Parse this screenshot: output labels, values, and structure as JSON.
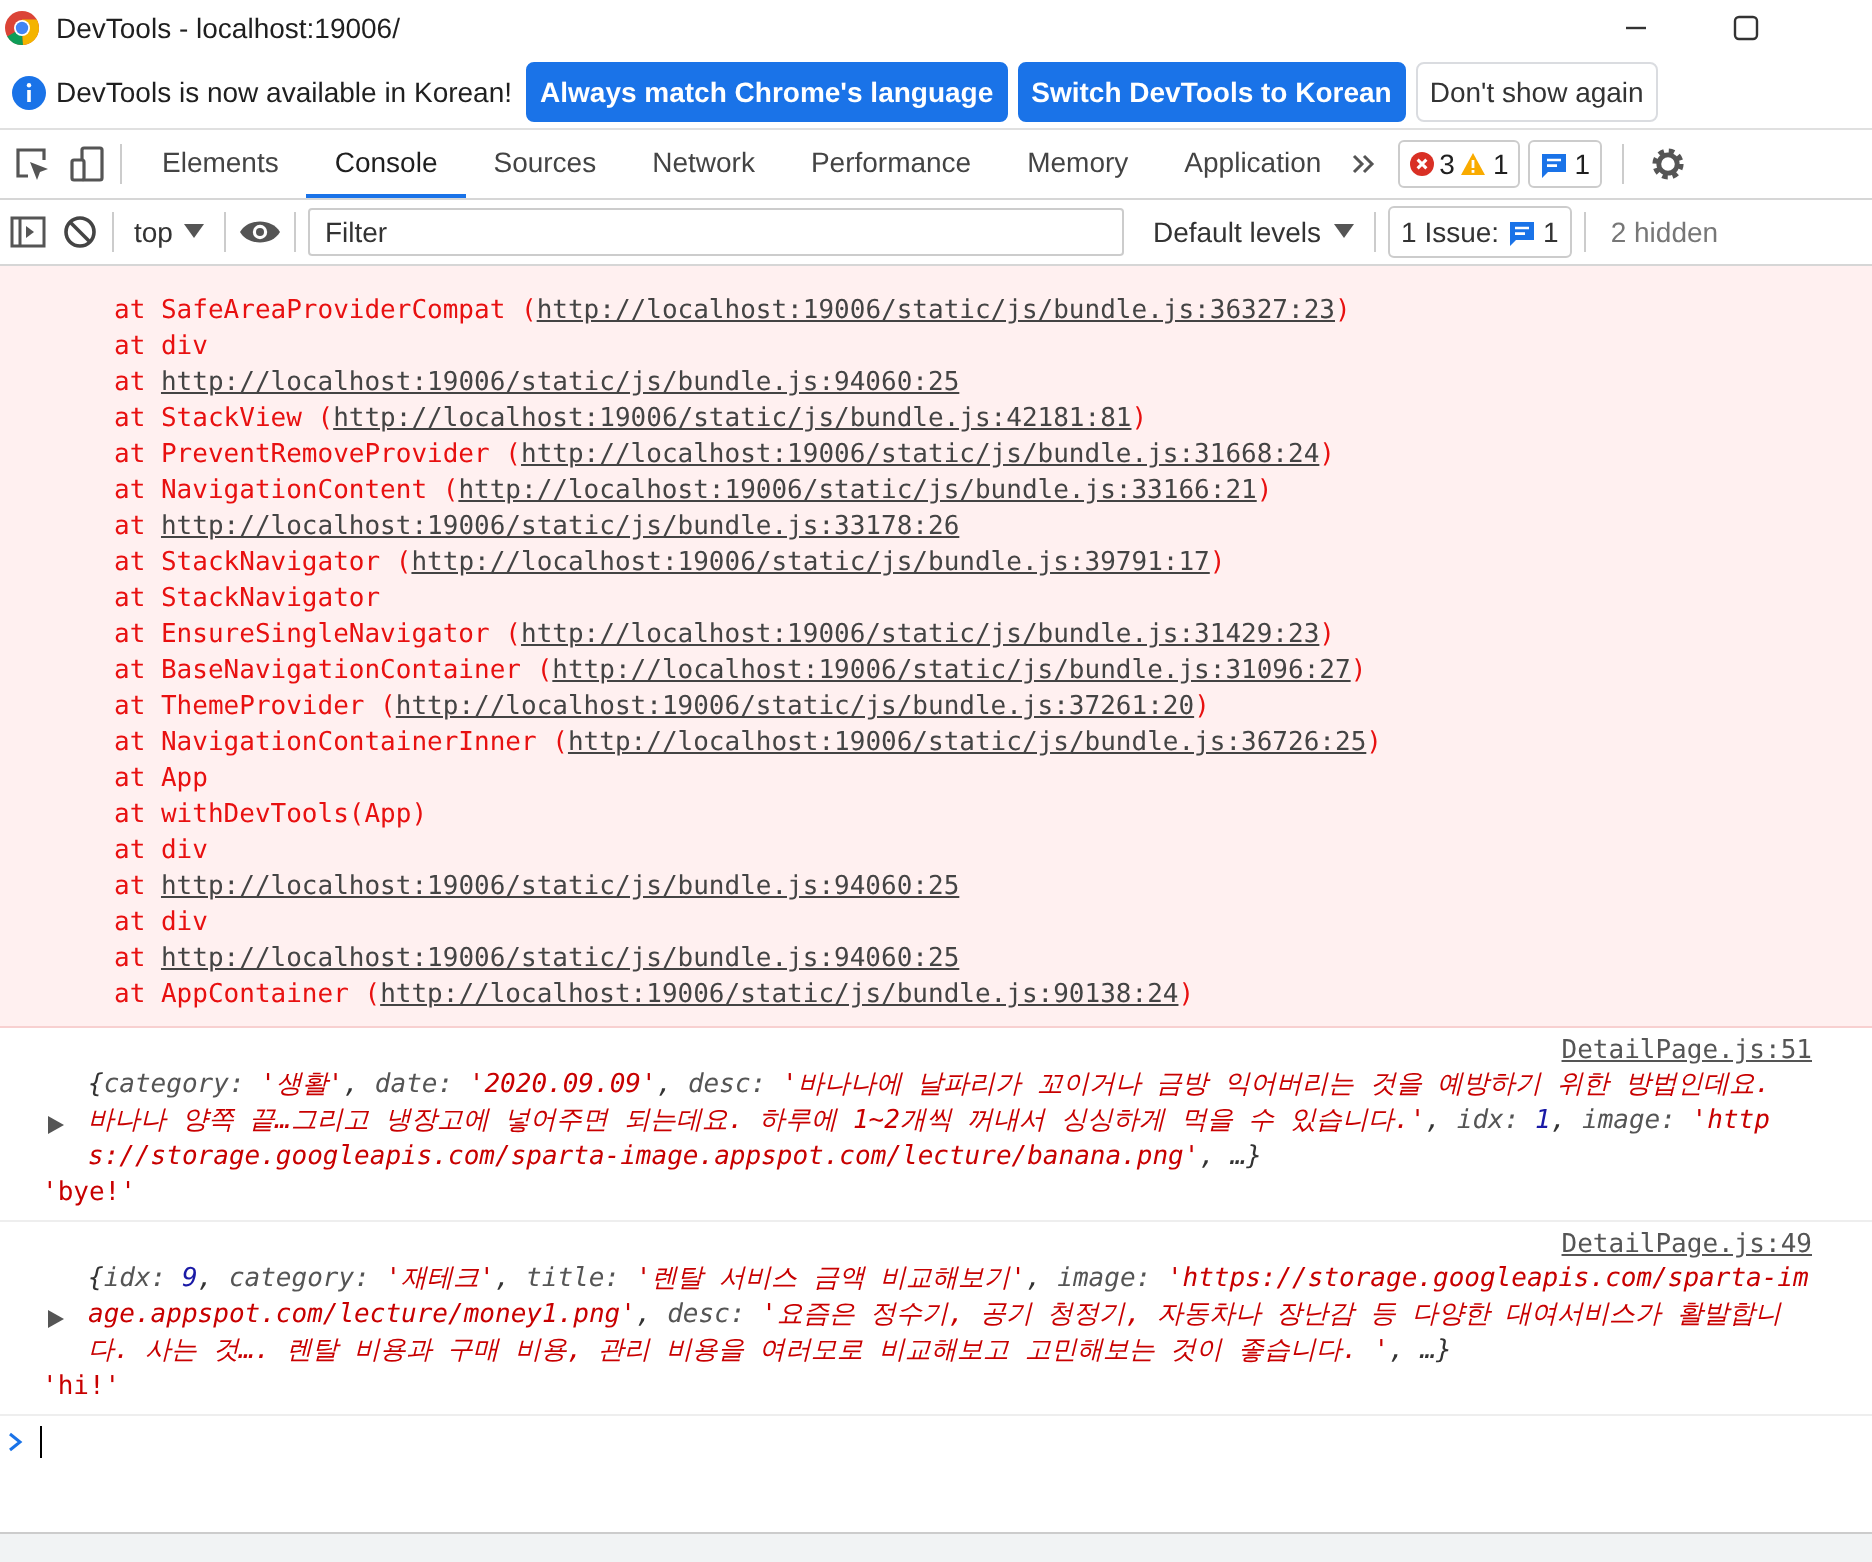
{
  "window": {
    "title": "DevTools - localhost:19006/"
  },
  "infobar": {
    "message": "DevTools is now available in Korean!",
    "buttons": [
      {
        "label": "Always match Chrome's language",
        "kind": "primary"
      },
      {
        "label": "Switch DevTools to Korean",
        "kind": "primary"
      },
      {
        "label": "Don't show again",
        "kind": "secondary"
      }
    ]
  },
  "tabs": [
    {
      "label": "Elements",
      "selected": false
    },
    {
      "label": "Console",
      "selected": true
    },
    {
      "label": "Sources",
      "selected": false
    },
    {
      "label": "Network",
      "selected": false
    },
    {
      "label": "Performance",
      "selected": false
    },
    {
      "label": "Memory",
      "selected": false
    },
    {
      "label": "Application",
      "selected": false
    }
  ],
  "counters": {
    "errors": "3",
    "warnings": "1",
    "messages": "1"
  },
  "console_toolbar": {
    "context": "top",
    "filter_placeholder": "Filter",
    "levels": "Default levels",
    "issues_label": "1 Issue:",
    "issues_count": "1",
    "hidden": "2 hidden"
  },
  "error_stack": [
    {
      "text": "at SafeAreaProviderCompat (",
      "link": "http://localhost:19006/static/js/bundle.js:36327:23",
      "after": ")"
    },
    {
      "text": "at div"
    },
    {
      "text": "at ",
      "link": "http://localhost:19006/static/js/bundle.js:94060:25"
    },
    {
      "text": "at StackView (",
      "link": "http://localhost:19006/static/js/bundle.js:42181:81",
      "after": ")"
    },
    {
      "text": "at PreventRemoveProvider (",
      "link": "http://localhost:19006/static/js/bundle.js:31668:24",
      "after": ")"
    },
    {
      "text": "at NavigationContent (",
      "link": "http://localhost:19006/static/js/bundle.js:33166:21",
      "after": ")"
    },
    {
      "text": "at ",
      "link": "http://localhost:19006/static/js/bundle.js:33178:26"
    },
    {
      "text": "at StackNavigator (",
      "link": "http://localhost:19006/static/js/bundle.js:39791:17",
      "after": ")"
    },
    {
      "text": "at StackNavigator"
    },
    {
      "text": "at EnsureSingleNavigator (",
      "link": "http://localhost:19006/static/js/bundle.js:31429:23",
      "after": ")"
    },
    {
      "text": "at BaseNavigationContainer (",
      "link": "http://localhost:19006/static/js/bundle.js:31096:27",
      "after": ")"
    },
    {
      "text": "at ThemeProvider (",
      "link": "http://localhost:19006/static/js/bundle.js:37261:20",
      "after": ")"
    },
    {
      "text": "at NavigationContainerInner (",
      "link": "http://localhost:19006/static/js/bundle.js:36726:25",
      "after": ")"
    },
    {
      "text": "at App"
    },
    {
      "text": "at withDevTools(App)"
    },
    {
      "text": "at div"
    },
    {
      "text": "at ",
      "link": "http://localhost:19006/static/js/bundle.js:94060:25"
    },
    {
      "text": "at div"
    },
    {
      "text": "at ",
      "link": "http://localhost:19006/static/js/bundle.js:94060:25"
    },
    {
      "text": "at AppContainer (",
      "link": "http://localhost:19006/static/js/bundle.js:90138:24",
      "after": ")"
    }
  ],
  "messages": [
    {
      "source": "DetailPage.js:51",
      "items": [
        {
          "kind": "object",
          "expanded": false,
          "tokens": [
            {
              "kind": "punct",
              "text": "{"
            },
            {
              "kind": "key",
              "text": "category: "
            },
            {
              "kind": "string",
              "text": "'생활'"
            },
            {
              "kind": "punct",
              "text": ", "
            },
            {
              "kind": "key",
              "text": "date: "
            },
            {
              "kind": "string",
              "text": "'2020.09.09'"
            },
            {
              "kind": "punct",
              "text": ", "
            },
            {
              "kind": "key",
              "text": "desc: "
            },
            {
              "kind": "string",
              "text": "'바나나에 날파리가 꼬이거나 금방 익어버리는 것을 예방하기 위한 방법인데요. 바나나 양쪽 끝…그리고 냉장고에 넣어주면 되는데요. 하루에 1~2개씩 꺼내서 싱싱하게 먹을 수 있습니다.'"
            },
            {
              "kind": "punct",
              "text": ", "
            },
            {
              "kind": "key",
              "text": "idx: "
            },
            {
              "kind": "number",
              "text": "1"
            },
            {
              "kind": "punct",
              "text": ", "
            },
            {
              "kind": "key",
              "text": "image: "
            },
            {
              "kind": "string",
              "text": "'https://storage.googleapis.com/sparta-image.appspot.com/lecture/banana.png'"
            },
            {
              "kind": "punct",
              "text": ", …}"
            }
          ]
        },
        {
          "kind": "string",
          "text": "'bye!'"
        }
      ]
    },
    {
      "source": "DetailPage.js:49",
      "items": [
        {
          "kind": "object",
          "expanded": false,
          "tokens": [
            {
              "kind": "punct",
              "text": "{"
            },
            {
              "kind": "key",
              "text": "idx: "
            },
            {
              "kind": "number",
              "text": "9"
            },
            {
              "kind": "punct",
              "text": ", "
            },
            {
              "kind": "key",
              "text": "category: "
            },
            {
              "kind": "string",
              "text": "'재테크'"
            },
            {
              "kind": "punct",
              "text": ", "
            },
            {
              "kind": "key",
              "text": "title: "
            },
            {
              "kind": "string",
              "text": "'렌탈 서비스 금액 비교해보기'"
            },
            {
              "kind": "punct",
              "text": ", "
            },
            {
              "kind": "key",
              "text": "image: "
            },
            {
              "kind": "string",
              "text": "'https://storage.googleapis.com/sparta-image.appspot.com/lecture/money1.png'"
            },
            {
              "kind": "punct",
              "text": ", "
            },
            {
              "kind": "key",
              "text": "desc: "
            },
            {
              "kind": "string",
              "text": "'요즘은 정수기, 공기 청정기, 자동차나 장난감 등 다양한 대여서비스가 활발합니다. 사는 것…. 렌탈 비용과 구매 비용, 관리 비용을 여러모로 비교해보고 고민해보는 것이 좋습니다. '"
            },
            {
              "kind": "punct",
              "text": ", …}"
            }
          ]
        },
        {
          "kind": "string",
          "text": "'hi!'"
        }
      ]
    }
  ]
}
